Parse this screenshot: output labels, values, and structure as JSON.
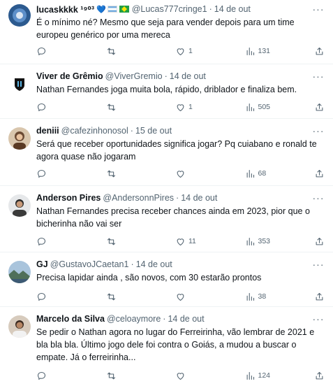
{
  "tweets": [
    {
      "name": "lucaskkkk ¹⁹⁰³",
      "badges": [
        "💙",
        "🇦🇷",
        "🇧🇷"
      ],
      "handle": "@Lucas777cringe1",
      "time": "14 de out",
      "text": "É o mínimo né?  Mesmo que seja para vender depois para um time europeu genérico por uma mereca",
      "replies": "",
      "retweets": "",
      "likes": "1",
      "views": "131",
      "avatar_color": "#3b6ea8"
    },
    {
      "name": "Viver de Grêmio",
      "badges": [],
      "handle": "@ViverGremio",
      "time": "14 de out",
      "text": "Nathan Fernandes joga muita bola, rápido, driblador e finaliza bem.",
      "replies": "",
      "retweets": "",
      "likes": "1",
      "views": "505",
      "avatar_color": "#ffffff"
    },
    {
      "name": "deniii",
      "badges": [],
      "handle": "@cafezinhonosol",
      "time": "15 de out",
      "text": "Será que receber oportunidades significa jogar? Pq cuiabano e ronald te agora quase não jogaram",
      "replies": "",
      "retweets": "",
      "likes": "",
      "views": "68",
      "avatar_color": "#8a6a4e"
    },
    {
      "name": "Anderson Pires",
      "badges": [],
      "handle": "@AndersonnPires",
      "time": "14 de out",
      "text": "Nathan Fernandes precisa receber chances ainda em 2023, pior que o bicherinha não vai ser",
      "replies": "",
      "retweets": "",
      "likes": "11",
      "views": "353",
      "avatar_color": "#c9cdd1"
    },
    {
      "name": "GJ",
      "badges": [],
      "handle": "@GustavoJCaetan1",
      "time": "14 de out",
      "text": "Precisa lapidar ainda , são novos, com 30 estarão prontos",
      "replies": "",
      "retweets": "",
      "likes": "",
      "views": "38",
      "avatar_color": "#7fa2c4"
    },
    {
      "name": "Marcelo da Silva",
      "badges": [],
      "handle": "@celoaymore",
      "time": "14 de out",
      "text": "Se pedir o Nathan agora no lugar do Ferreirinha, vão lembrar de 2021 e bla bla bla. Último jogo dele foi contra o Goiás, a mudou a buscar o empate. Já o ferreirinha...",
      "replies": "",
      "retweets": "",
      "likes": "",
      "views": "124",
      "avatar_color": "#a0856b"
    }
  ],
  "icons": {
    "reply": "reply-icon",
    "retweet": "retweet-icon",
    "like": "heart-icon",
    "views": "views-icon",
    "share": "share-icon",
    "more": "more-icon"
  }
}
